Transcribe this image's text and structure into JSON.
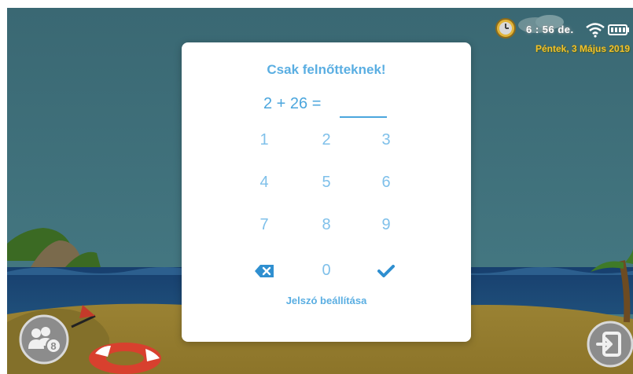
{
  "status_bar": {
    "time": "6 : 56 de.",
    "date": "Péntek, 3 Május 2019",
    "icons": [
      "clock-icon",
      "wifi-icon",
      "battery-icon"
    ]
  },
  "dialog": {
    "title": "Csak felnőtteknek!",
    "equation": "2 + 26 =",
    "answer": "",
    "keys": {
      "k1": "1",
      "k2": "2",
      "k3": "3",
      "k4": "4",
      "k5": "5",
      "k6": "6",
      "k7": "7",
      "k8": "8",
      "k9": "9",
      "k0": "0",
      "backspace_icon": "backspace-icon",
      "confirm_icon": "checkmark-icon"
    },
    "link_label": "Jelszó beállítása"
  },
  "corner_buttons": {
    "left_icon": "users-group-icon",
    "right_icon": "exit-icon"
  },
  "colors": {
    "accent": "#5aaee2",
    "key_text": "#7fc0ea",
    "date_text": "#f2c12e",
    "sky_overlay": "#3f6f7a",
    "sand": "#a08a3a"
  }
}
